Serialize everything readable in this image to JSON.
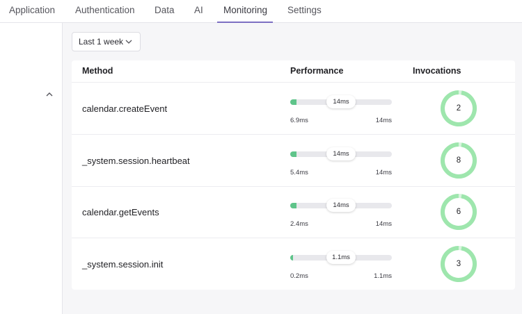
{
  "nav": {
    "tabs": [
      {
        "label": "Application"
      },
      {
        "label": "Authentication"
      },
      {
        "label": "Data"
      },
      {
        "label": "AI"
      },
      {
        "label": "Monitoring"
      },
      {
        "label": "Settings"
      }
    ],
    "active_tab": "Monitoring"
  },
  "filter": {
    "range_label": "Last 1 week"
  },
  "table": {
    "headers": {
      "method": "Method",
      "performance": "Performance",
      "invocations": "Invocations"
    },
    "rows": [
      {
        "method": "calendar.createEvent",
        "current": "14ms",
        "min": "6.9ms",
        "max": "14ms",
        "fill_fraction": 0.06,
        "invocations": "2"
      },
      {
        "method": "_system.session.heartbeat",
        "current": "14ms",
        "min": "5.4ms",
        "max": "14ms",
        "fill_fraction": 0.06,
        "invocations": "8"
      },
      {
        "method": "calendar.getEvents",
        "current": "14ms",
        "min": "2.4ms",
        "max": "14ms",
        "fill_fraction": 0.06,
        "invocations": "6"
      },
      {
        "method": "_system.session.init",
        "current": "1.1ms",
        "min": "0.2ms",
        "max": "1.1ms",
        "fill_fraction": 0.02,
        "invocations": "3"
      }
    ]
  },
  "colors": {
    "accent": "#7c6fc2",
    "bar_fill": "#5fc48a",
    "donut": "#9ee6ad",
    "donut_gap": "#d8f5de"
  }
}
